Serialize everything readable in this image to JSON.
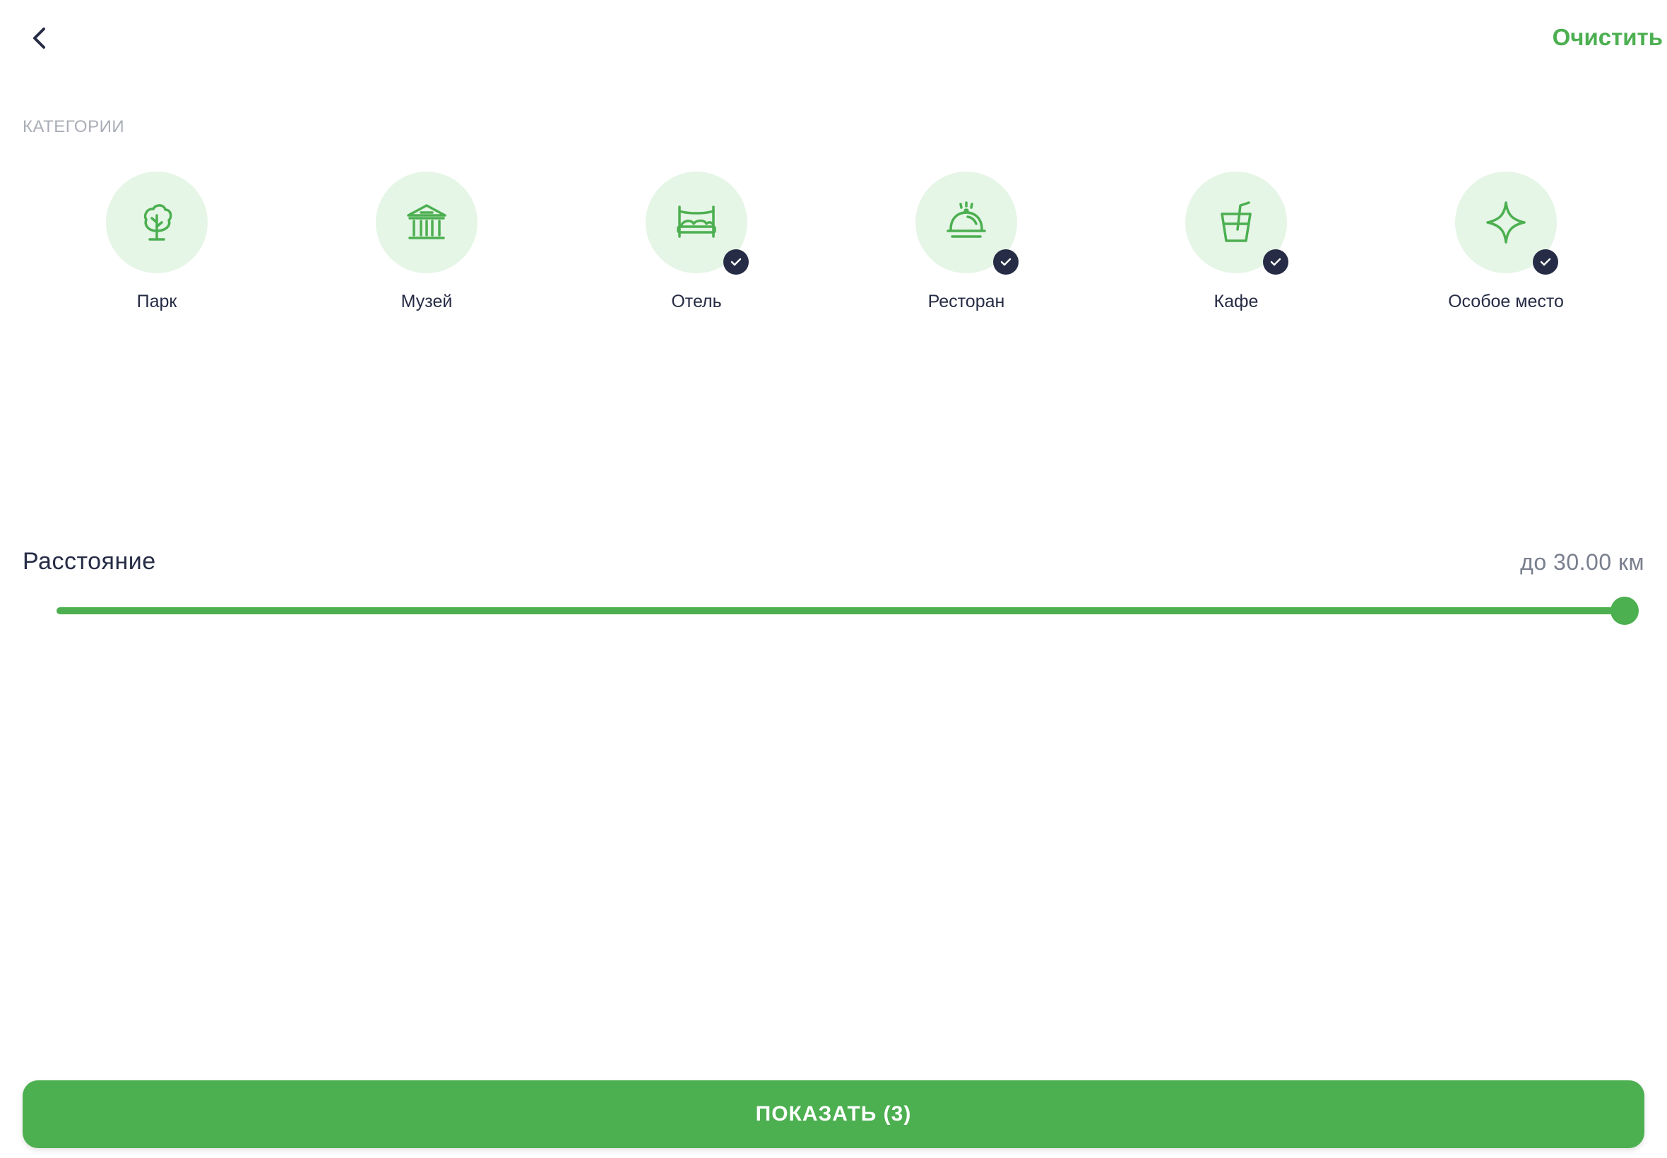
{
  "header": {
    "back_icon": "chevron-left-icon",
    "clear_label": "Очистить"
  },
  "categories": {
    "section_label": "КАТЕГОРИИ",
    "items": [
      {
        "label": "Парк",
        "icon": "tree-icon",
        "selected": false
      },
      {
        "label": "Музей",
        "icon": "museum-icon",
        "selected": false
      },
      {
        "label": "Отель",
        "icon": "bed-icon",
        "selected": true
      },
      {
        "label": "Ресторан",
        "icon": "cloche-icon",
        "selected": true
      },
      {
        "label": "Кафе",
        "icon": "drink-icon",
        "selected": true
      },
      {
        "label": "Особое место",
        "icon": "sparkle-icon",
        "selected": true
      }
    ]
  },
  "distance": {
    "title": "Расстояние",
    "value_label": "до 30.00 км",
    "slider_fraction": 1.0
  },
  "footer": {
    "show_button_label": "ПОКАЗАТЬ (3)"
  },
  "colors": {
    "accent": "#4caf50",
    "accent_light": "#e5f5e6",
    "text_dark": "#262c45",
    "text_muted": "#a9adb5",
    "check_badge": "#262c45"
  }
}
